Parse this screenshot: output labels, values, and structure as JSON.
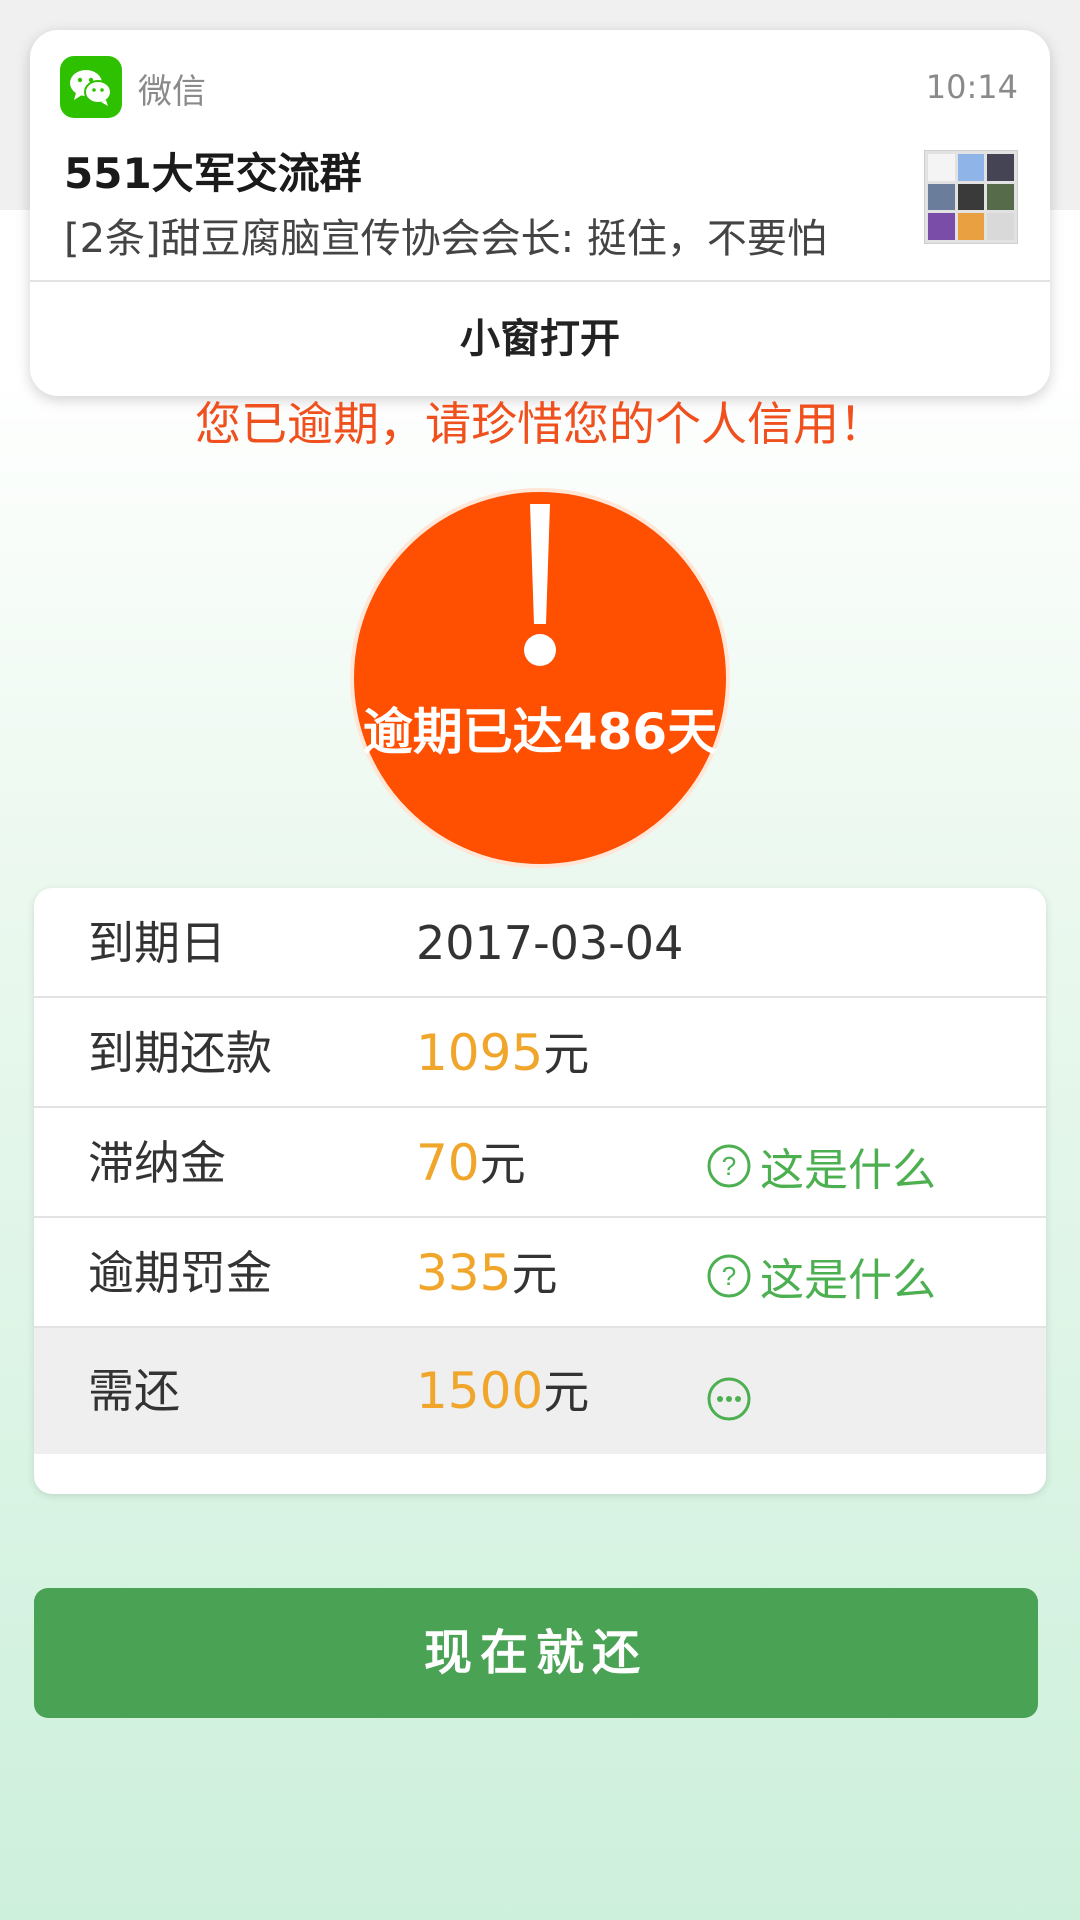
{
  "notification": {
    "app_name": "微信",
    "time": "10:14",
    "title": "551大军交流群",
    "message": "[2条]甜豆腐脑宣传协会会长: 挺住，不要怕",
    "action": "小窗打开"
  },
  "warning_text": "您已逾期，请珍惜您的个人信用！",
  "overdue": {
    "text_prefix": "逾期已达",
    "days": "486",
    "text_suffix": "天"
  },
  "rows": [
    {
      "label": "到期日",
      "value": "2017-03-04",
      "unit": ""
    },
    {
      "label": "到期还款",
      "value": "1095",
      "unit": "元"
    },
    {
      "label": "滞纳金",
      "value": "70",
      "unit": "元",
      "help": "这是什么"
    },
    {
      "label": "逾期罚金",
      "value": "335",
      "unit": "元",
      "help": "这是什么"
    },
    {
      "label": "需还",
      "value": "1500",
      "unit": "元"
    }
  ],
  "pay_button": "现在就还",
  "colors": {
    "accent_green": "#4aa255",
    "alert_orange": "#fe5000",
    "amount_yellow": "#f0a62b",
    "wechat_green": "#2dc100"
  },
  "icons": [
    "wechat-icon",
    "exclamation-icon",
    "question-circle-icon",
    "more-circle-icon"
  ]
}
